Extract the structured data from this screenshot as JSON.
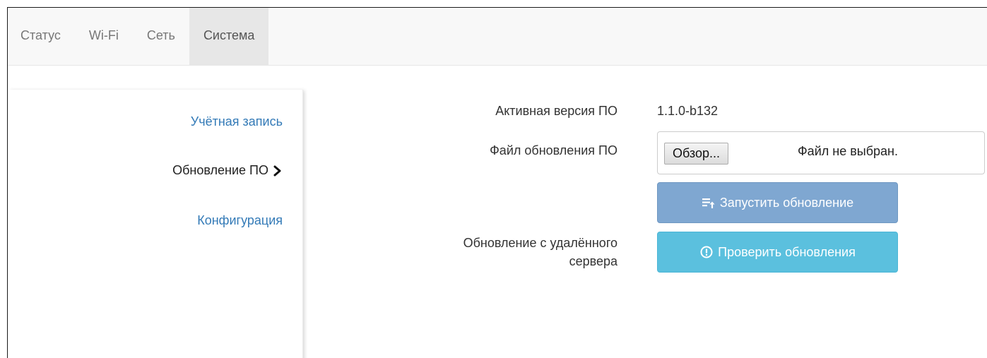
{
  "topnav": {
    "tabs": [
      {
        "label": "Статус"
      },
      {
        "label": "Wi-Fi"
      },
      {
        "label": "Сеть"
      },
      {
        "label": "Система",
        "active": true
      }
    ]
  },
  "sidebar": {
    "items": [
      {
        "label": "Учётная запись",
        "type": "link"
      },
      {
        "label": "Обновление ПО",
        "type": "active"
      },
      {
        "label": "Конфигурация",
        "type": "link"
      }
    ]
  },
  "form": {
    "active_version_label": "Активная версия ПО",
    "active_version_value": "1.1.0-b132",
    "update_file_label": "Файл обновления ПО",
    "browse_label": "Обзор...",
    "file_status": "Файл не выбран.",
    "start_update_label": "Запустить обновление",
    "remote_update_label_line1": "Обновление с удалённого",
    "remote_update_label_line2": "сервера",
    "check_updates_label": "Проверить обновления"
  },
  "icons": {
    "chevron": "chevron-right-icon",
    "start_update": "upload-list-icon",
    "check_updates": "info-circle-icon"
  },
  "colors": {
    "link": "#337ab7",
    "start_update_button": "#7fa7d1",
    "check_updates_button": "#5bc0de",
    "nav_active_bg": "#e7e7e7"
  }
}
